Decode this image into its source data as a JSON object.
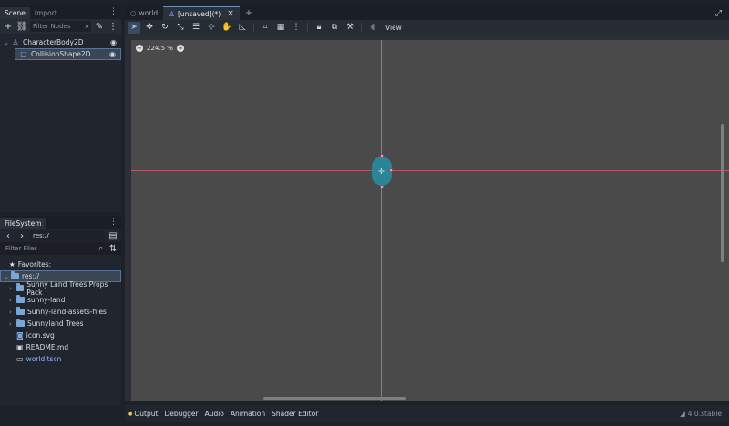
{
  "scene_dock": {
    "tabs": [
      "Scene",
      "Import"
    ],
    "filter_placeholder": "Filter Nodes",
    "nodes": [
      {
        "label": "CharacterBody2D",
        "icon": "character-body-icon"
      },
      {
        "label": "CollisionShape2D",
        "icon": "collision-shape-icon"
      }
    ]
  },
  "filesystem_dock": {
    "tab": "FileSystem",
    "path": "res://",
    "filter_placeholder": "Filter Files",
    "favorites_label": "Favorites:",
    "root_label": "res://",
    "items": [
      {
        "label": "Sunny Land Trees Props Pack",
        "type": "folder"
      },
      {
        "label": "sunny-land",
        "type": "folder"
      },
      {
        "label": "Sunny-land-assets-files",
        "type": "folder"
      },
      {
        "label": "Sunnyland Trees",
        "type": "folder"
      },
      {
        "label": "icon.svg",
        "type": "svg"
      },
      {
        "label": "README.md",
        "type": "markdown"
      },
      {
        "label": "world.tscn",
        "type": "scene"
      }
    ]
  },
  "editor": {
    "tabs": [
      {
        "label": "world",
        "active": false
      },
      {
        "label": "[unsaved](*)",
        "active": true
      }
    ],
    "view_label": "View",
    "zoom_label": "224.5 %"
  },
  "bottom_bar": {
    "items": [
      "Output",
      "Debugger",
      "Audio",
      "Animation",
      "Shader Editor"
    ],
    "version": "4.0.stable"
  },
  "colors": {
    "accent": "#6b8fbd",
    "x_axis": "#b35b68",
    "y_axis": "#6f9a3c",
    "capsule": "#2b8597",
    "folder": "#7aa6d6"
  }
}
